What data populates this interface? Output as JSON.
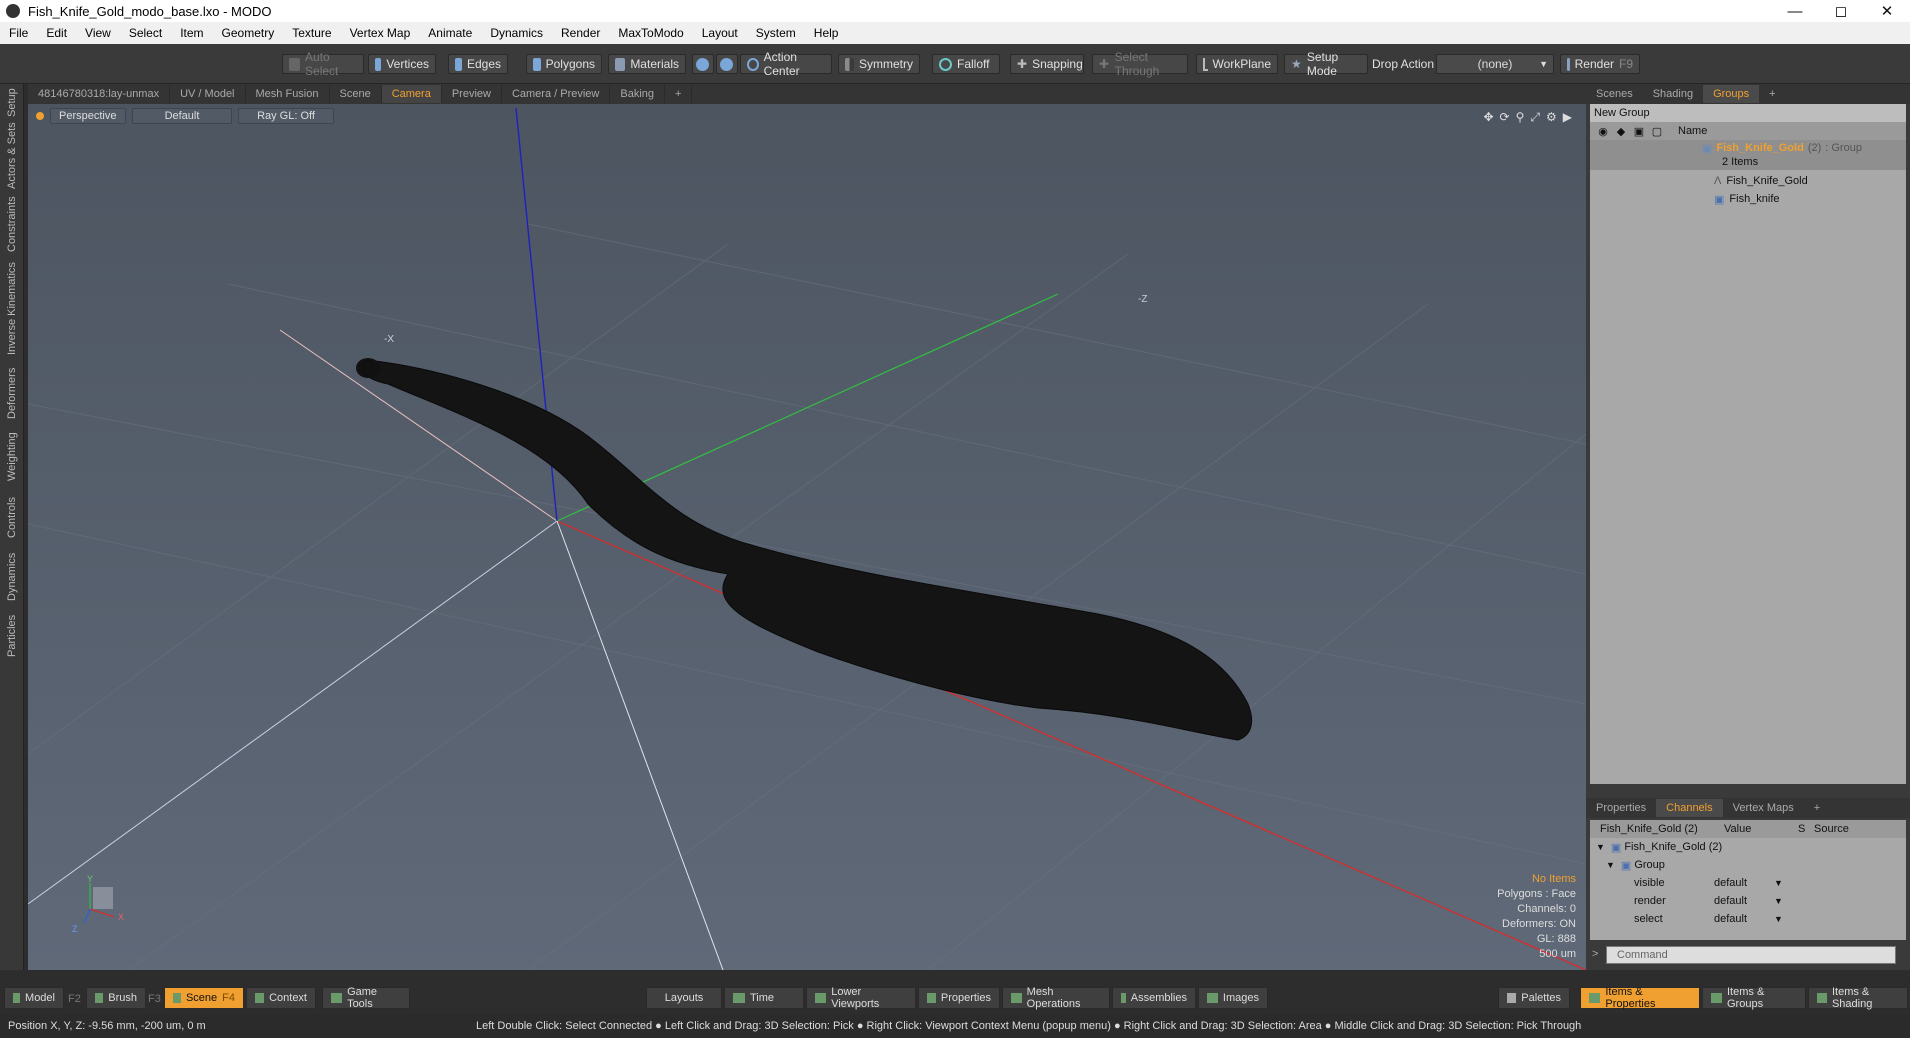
{
  "window": {
    "title": "Fish_Knife_Gold_modo_base.lxo - MODO"
  },
  "menu": [
    "File",
    "Edit",
    "View",
    "Select",
    "Item",
    "Geometry",
    "Texture",
    "Vertex Map",
    "Animate",
    "Dynamics",
    "Render",
    "MaxToModo",
    "Layout",
    "System",
    "Help"
  ],
  "toolbar": {
    "auto_select": "Auto Select",
    "vertices": "Vertices",
    "edges": "Edges",
    "polygons": "Polygons",
    "materials": "Materials",
    "action_center": "Action Center",
    "symmetry": "Symmetry",
    "falloff": "Falloff",
    "snapping": "Snapping",
    "select_through": "Select Through",
    "workplane": "WorkPlane",
    "setup_mode": "Setup Mode",
    "drop_action": "Drop Action",
    "drop_value": "(none)",
    "render": "Render",
    "render_key": "F9"
  },
  "left_tabs": [
    "Setup",
    "Actors & Sets",
    "Constraints",
    "Inverse Kinematics",
    "Deformers",
    "Weighting",
    "Controls",
    "Dynamics",
    "Particles"
  ],
  "viewport_tabs": [
    {
      "label": "48146780318:lay-unmax"
    },
    {
      "label": "UV / Model"
    },
    {
      "label": "Mesh Fusion"
    },
    {
      "label": "Scene"
    },
    {
      "label": "Camera",
      "active": true
    },
    {
      "label": "Preview"
    },
    {
      "label": "Camera / Preview"
    },
    {
      "label": "Baking"
    },
    {
      "label": "+"
    }
  ],
  "viewport": {
    "view_mode": "Perspective",
    "shading": "Default",
    "raygl": "Ray GL: Off",
    "axis_label_y": "Y",
    "axis_label_x": "X",
    "axis_label_z": "Z",
    "axis_label_neg_x": "-X",
    "axis_label_neg_z": "-Z",
    "info": {
      "items": "No Items",
      "polygons": "Polygons : Face",
      "channels": "Channels: 0",
      "deformers": "Deformers: ON",
      "gl": "GL: 888",
      "scale": "500 um"
    }
  },
  "right_tabs": [
    {
      "label": "Scenes"
    },
    {
      "label": "Shading"
    },
    {
      "label": "Groups",
      "active": true
    },
    {
      "label": "+"
    }
  ],
  "groups": {
    "new_group": "New Group",
    "name_header": "Name",
    "group_name": "Fish_Knife_Gold",
    "group_count": "(2)",
    "group_type": ": Group",
    "items_count": "2 Items",
    "children": [
      "Fish_Knife_Gold",
      "Fish_knife"
    ]
  },
  "props_tabs": [
    {
      "label": "Properties"
    },
    {
      "label": "Channels",
      "active": true
    },
    {
      "label": "Vertex Maps"
    },
    {
      "label": "+"
    }
  ],
  "channels": {
    "title": "Fish_Knife_Gold (2)",
    "col_value": "Value",
    "col_s": "S",
    "col_source": "Source",
    "item": "Fish_Knife_Gold (2)",
    "group": "Group",
    "rows": [
      {
        "name": "visible",
        "value": "default"
      },
      {
        "name": "render",
        "value": "default"
      },
      {
        "name": "select",
        "value": "default"
      }
    ]
  },
  "command_placeholder": "Command",
  "bottom": {
    "model": "Model",
    "model_key": "F2",
    "brush": "Brush",
    "brush_key": "F3",
    "scene": "Scene",
    "scene_key": "F4",
    "context": "Context",
    "game_tools": "Game Tools",
    "layouts": "Layouts",
    "time": "Time",
    "lower_viewports": "Lower Viewports",
    "properties": "Properties",
    "mesh_operations": "Mesh Operations",
    "assemblies": "Assemblies",
    "images": "Images",
    "palettes": "Palettes",
    "items_properties": "Items & Properties",
    "items_groups": "Items & Groups",
    "items_shading": "Items & Shading"
  },
  "status": {
    "position": "Position X, Y, Z:  -9.56 mm, -200 um, 0 m",
    "hint": "Left Double Click: Select Connected ● Left Click and Drag: 3D Selection: Pick ● Right Click: Viewport Context Menu (popup menu) ● Right Click and Drag: 3D Selection: Area ● Middle Click and Drag: 3D Selection: Pick Through"
  },
  "colors": {
    "accent": "#f0a030",
    "viewport_top": "#4d5561",
    "viewport_bottom": "#5f6978",
    "axis_x": "#d03030",
    "axis_y": "#30c040",
    "axis_z": "#2020c0"
  }
}
